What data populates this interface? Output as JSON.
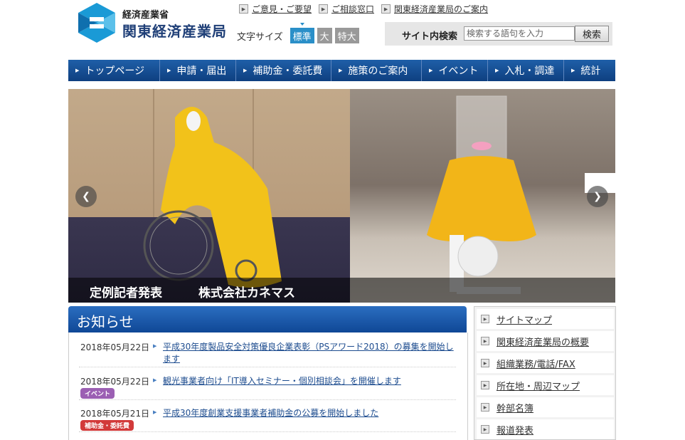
{
  "header": {
    "org_sub": "経済産業省",
    "org_main": "関東経済産業局",
    "top_links": [
      "ご意見・ご要望",
      "ご相談窓口",
      "関東経済産業局のご案内"
    ],
    "font_size_label": "文字サイズ",
    "font_sizes": [
      {
        "label": "標準",
        "active": true
      },
      {
        "label": "大",
        "active": false
      },
      {
        "label": "特大",
        "active": false
      }
    ],
    "search_label": "サイト内検索",
    "search_placeholder": "検索する語句を入力",
    "search_button": "検索"
  },
  "nav": [
    {
      "label": "トップページ"
    },
    {
      "label": "申請・届出"
    },
    {
      "label": "補助金・委託費"
    },
    {
      "label": "施策のご案内"
    },
    {
      "label": "イベント"
    },
    {
      "label": "入札・調達"
    },
    {
      "label": "統計"
    }
  ],
  "hero": {
    "caption_1": "定例記者発表",
    "caption_2": "株式会社カネマス"
  },
  "news": {
    "title": "お知らせ",
    "items": [
      {
        "date": "2018年05月22日",
        "text": "平成30年度製品安全対策優良企業表彰（PSアワード2018）の募集を開始します",
        "tag": ""
      },
      {
        "date": "2018年05月22日",
        "text": "観光事業者向け「IT導入セミナー・個別相談会」を開催します",
        "tag": "イベント"
      },
      {
        "date": "2018年05月21日",
        "text": "平成30年度創業支援事業者補助金の公募を開始しました",
        "tag": "補助金・委託費"
      }
    ]
  },
  "side_links": [
    "サイトマップ",
    "関東経済産業局の概要",
    "組織業務/電話/FAX",
    "所在地・周辺マップ",
    "幹部名簿",
    "報道発表"
  ],
  "colors": {
    "nav": "#1f5fa8",
    "accent": "#2a8fc8",
    "event_tag": "#9b5fb3",
    "subsidy_tag": "#d23a3a"
  }
}
